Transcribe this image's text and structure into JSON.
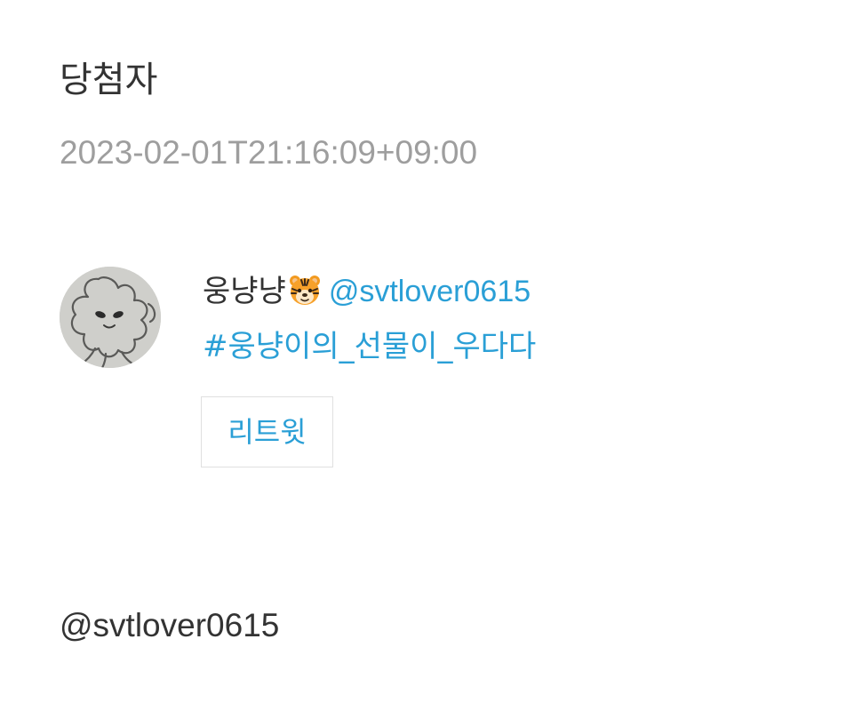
{
  "section": {
    "title": "당첨자",
    "timestamp": "2023-02-01T21:16:09+09:00"
  },
  "tweet": {
    "display_name": "웅냥냥",
    "name_emoji": "tiger-face-icon",
    "mention": "@svtlover0615",
    "hashtag": "#웅냥이의_선물이_우다다",
    "retweet_label": "리트윗",
    "avatar_icon": "doodle-character-avatar"
  },
  "footer": {
    "handle": "@svtlover0615"
  },
  "colors": {
    "link": "#2a9fd6",
    "text": "#333333",
    "muted": "#9e9e9e",
    "border": "#e0e0e0"
  }
}
